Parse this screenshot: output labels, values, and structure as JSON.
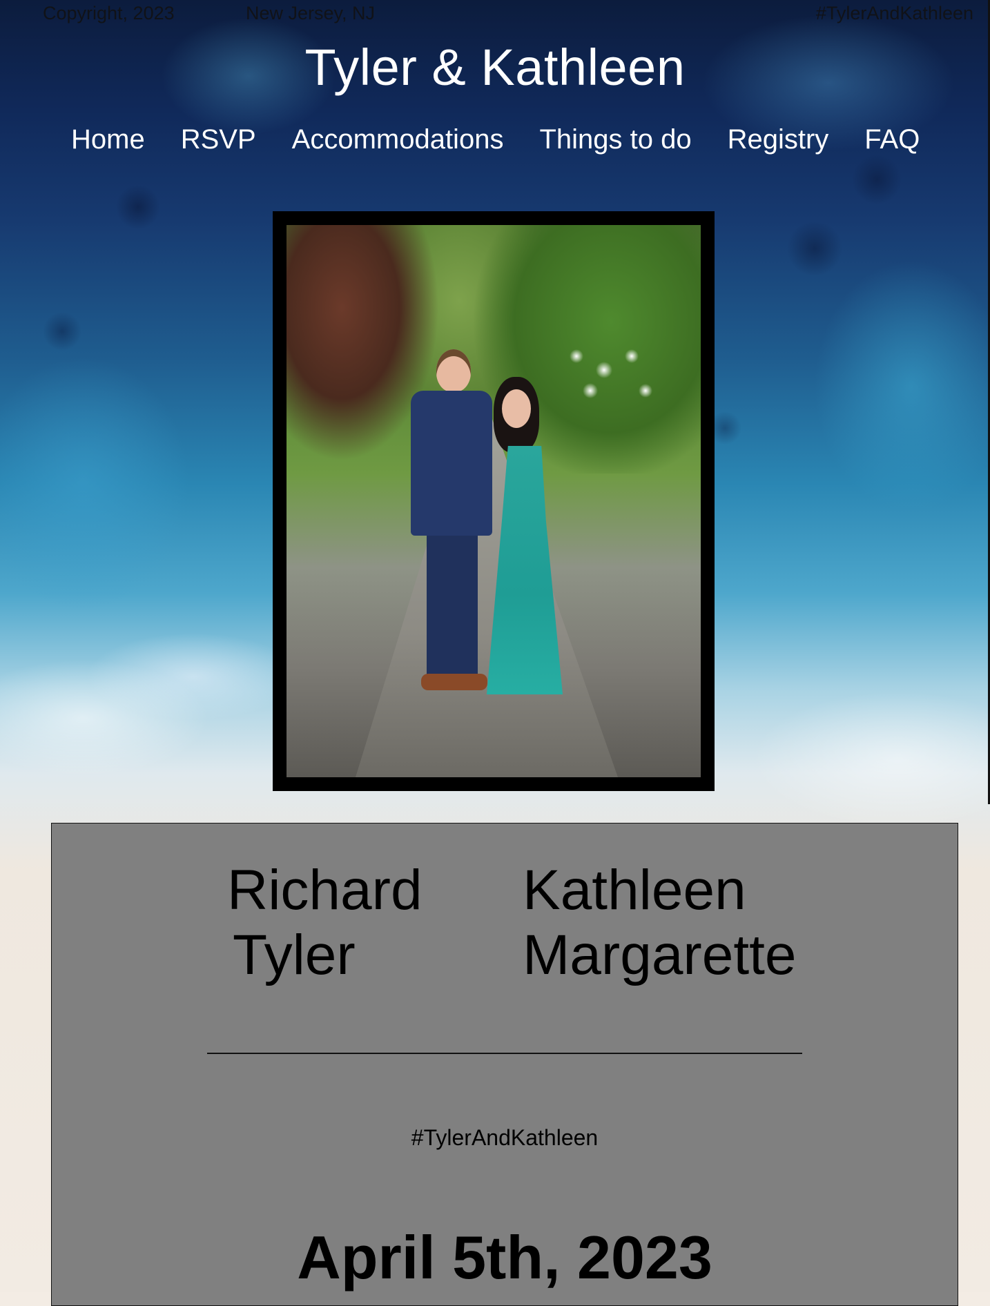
{
  "topbar": {
    "copyright": "Copyright, 2023",
    "location": "New Jersey, NJ",
    "hashtag": "#TylerAndKathleen"
  },
  "site": {
    "title": "Tyler & Kathleen"
  },
  "nav": {
    "items": [
      "Home",
      "RSVP",
      "Accommodations",
      "Things to do",
      "Registry",
      "FAQ"
    ]
  },
  "couple": {
    "left_first": "Richard",
    "left_second": "Tyler",
    "right_first": "Kathleen",
    "right_second": "Margarette"
  },
  "card": {
    "hashtag": "#TylerAndKathleen",
    "date": "April 5th, 2023"
  },
  "colors": {
    "card_background": "#808080",
    "nav_text": "#ffffff",
    "frame": "#000000"
  }
}
